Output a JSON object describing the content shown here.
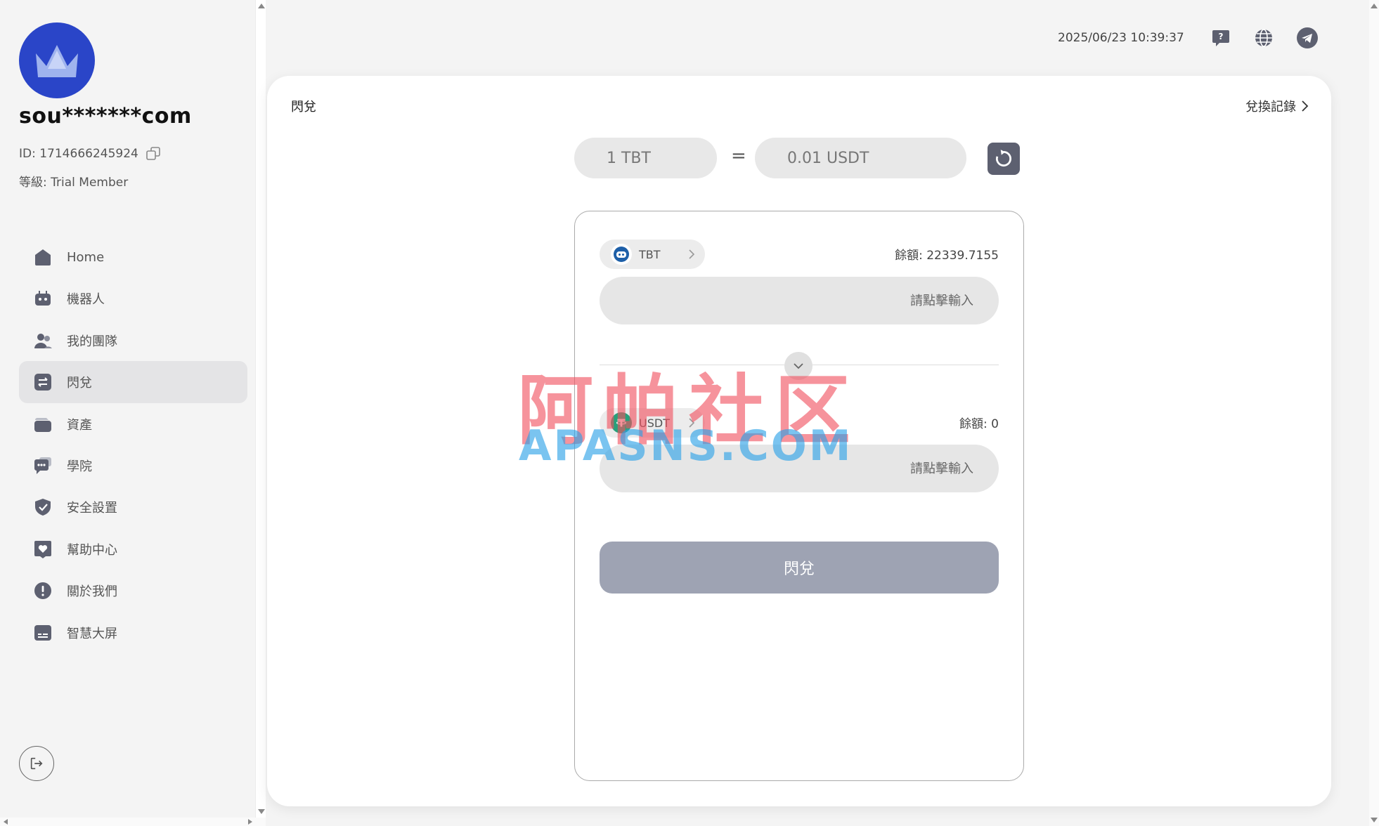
{
  "sidebar": {
    "username": "sou*******com",
    "id_text": "ID: 1714666245924",
    "level_text": "等級: Trial Member",
    "items": [
      {
        "label": "Home",
        "icon": "home-icon"
      },
      {
        "label": "機器人",
        "icon": "robot-icon"
      },
      {
        "label": "我的團隊",
        "icon": "team-icon"
      },
      {
        "label": "閃兌",
        "icon": "swap-icon",
        "active": true
      },
      {
        "label": "資產",
        "icon": "wallet-icon"
      },
      {
        "label": "學院",
        "icon": "chat-icon"
      },
      {
        "label": "安全設置",
        "icon": "shield-icon"
      },
      {
        "label": "幫助中心",
        "icon": "heart-icon"
      },
      {
        "label": "關於我們",
        "icon": "info-icon"
      },
      {
        "label": "智慧大屏",
        "icon": "screen-icon"
      }
    ]
  },
  "header": {
    "datetime": "2025/06/23 10:39:37"
  },
  "card": {
    "title": "閃兌",
    "history_label": "兌換記錄",
    "rate_from": "1 TBT",
    "rate_equal": "=",
    "rate_to": "0.01 USDT"
  },
  "swap": {
    "from_coin": "TBT",
    "from_balance": "餘額: 22339.7155",
    "from_placeholder": "請點擊輸入",
    "to_coin": "USDT",
    "to_balance": "餘額: 0",
    "to_placeholder": "請點擊輸入",
    "submit_label": "閃兌"
  },
  "watermark": {
    "cn": "阿帕社区",
    "en": "APASNS.COM"
  },
  "colors": {
    "avatar_bg": "#2a45c8",
    "nav_icon": "#5d6070",
    "submit_bg": "#9ea3b3"
  }
}
